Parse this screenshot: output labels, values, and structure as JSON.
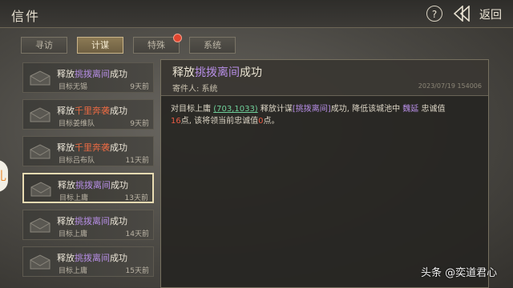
{
  "header": {
    "title": "信件",
    "help": "?",
    "back_label": "返回"
  },
  "tabs": [
    {
      "label": "寻访",
      "active": false,
      "badge": false
    },
    {
      "label": "计谋",
      "active": true,
      "badge": false
    },
    {
      "label": "特殊",
      "active": false,
      "badge": true
    },
    {
      "label": "系统",
      "active": false,
      "badge": false
    }
  ],
  "mails": [
    {
      "pre": "释放",
      "hl": "挑拨离间",
      "post": "成功",
      "hl_color": "#b78ee6",
      "target": "目标无锡",
      "time": "9天前",
      "selected": false
    },
    {
      "pre": "释放",
      "hl": "千里奔袭",
      "post": "成功",
      "hl_color": "#e86a43",
      "target": "目标姜维队",
      "time": "9天前",
      "selected": false
    },
    {
      "pre": "释放",
      "hl": "千里奔袭",
      "post": "成功",
      "hl_color": "#e86a43",
      "target": "目标吕布队",
      "time": "11天前",
      "selected": false
    },
    {
      "pre": "释放",
      "hl": "挑拨离间",
      "post": "成功",
      "hl_color": "#b78ee6",
      "target": "目标上庸",
      "time": "13天前",
      "selected": true
    },
    {
      "pre": "释放",
      "hl": "挑拨离间",
      "post": "成功",
      "hl_color": "#b78ee6",
      "target": "目标上庸",
      "time": "14天前",
      "selected": false
    },
    {
      "pre": "释放",
      "hl": "挑拨离间",
      "post": "成功",
      "hl_color": "#b78ee6",
      "target": "目标上庸",
      "time": "15天前",
      "selected": false
    }
  ],
  "detail": {
    "title_pre": "释放",
    "title_hl": "挑拨离间",
    "title_post": "成功",
    "sender": "寄件人: 系统",
    "date": "2023/07/19 154006",
    "body": {
      "t1": "对目标上庸 ",
      "coords": "(703,1033)",
      "t2": " 释放计谋",
      "skill": "[挑拨离间]",
      "t3": "成功, 降低该城池中 ",
      "general": "魏延",
      "t4": " 忠诚值",
      "value": "16",
      "t5": "点, 该将领当前忠诚值",
      "current": "0",
      "t6": "点。"
    }
  },
  "side_badge": "礼",
  "watermark": "头条 @奕道君心"
}
